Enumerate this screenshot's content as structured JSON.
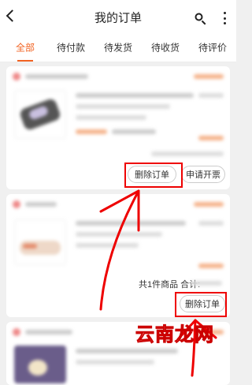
{
  "header": {
    "title": "我的订单"
  },
  "tabs": [
    "全部",
    "待付款",
    "待发货",
    "待收货",
    "待评价"
  ],
  "order1": {
    "buttons": {
      "delete": "删除订单",
      "invoice": "申请开票"
    }
  },
  "order2": {
    "summary": "共1件商品 合计:",
    "buttons": {
      "delete": "删除订单"
    }
  },
  "watermark": "云南龙网",
  "colors": {
    "accent": "#f26322",
    "annotation": "#e00000"
  }
}
